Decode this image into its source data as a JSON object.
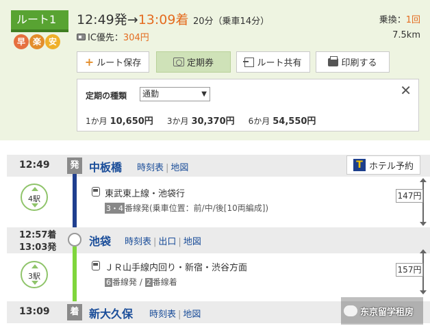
{
  "route": {
    "label": "ルート1",
    "badges": [
      "早",
      "楽",
      "安"
    ],
    "depart_time": "12:49発",
    "arrow": "→",
    "arrive_time": "13:09着",
    "duration": "20分（乗車14分）",
    "transfer_label": "乗換：",
    "transfer_count": "1回",
    "fare_label": "IC優先：",
    "fare_value": "304円",
    "distance": "7.5km"
  },
  "actions": {
    "save": "ルート保存",
    "teiki": "定期券",
    "share": "ルート共有",
    "print": "印刷する"
  },
  "teiki_panel": {
    "kind_label": "定期の種類",
    "kind_selected": "通勤",
    "caret": "▼",
    "close": "✕",
    "prices": [
      {
        "period": "1か月",
        "price": "10,650円"
      },
      {
        "period": "3か月",
        "price": "30,370円"
      },
      {
        "period": "6か月",
        "price": "54,550円"
      }
    ]
  },
  "timeline": {
    "links": {
      "timetable": "時刻表",
      "exit": "出口",
      "map": "地図",
      "sep": "|"
    },
    "hotel": {
      "logo": "T",
      "label": "ホテル予約"
    },
    "stations": [
      {
        "time": "12:49",
        "tag": "発",
        "name": "中板橋"
      },
      {
        "time_arr": "12:57着",
        "time_dep": "13:03発",
        "name": "池袋"
      },
      {
        "time": "13:09",
        "tag": "着",
        "name": "新大久保"
      }
    ],
    "segments": [
      {
        "stops": "4駅",
        "line": "東武東上線・池袋行",
        "platform_num": "3・4",
        "platform_text": "番線発(乗車位置：前/中/後[10両編成])",
        "fare": "147円",
        "color": "#1f3f8f"
      },
      {
        "stops": "3駅",
        "line": "ＪＲ山手線内回り・新宿・渋谷方面",
        "platform_num_dep": "6",
        "platform_text_dep": "番線発 /",
        "platform_num_arr": "2",
        "platform_text_arr": "番線着",
        "fare": "157円",
        "color": "#7fd63c"
      }
    ]
  },
  "watermark": "东京留学租房"
}
